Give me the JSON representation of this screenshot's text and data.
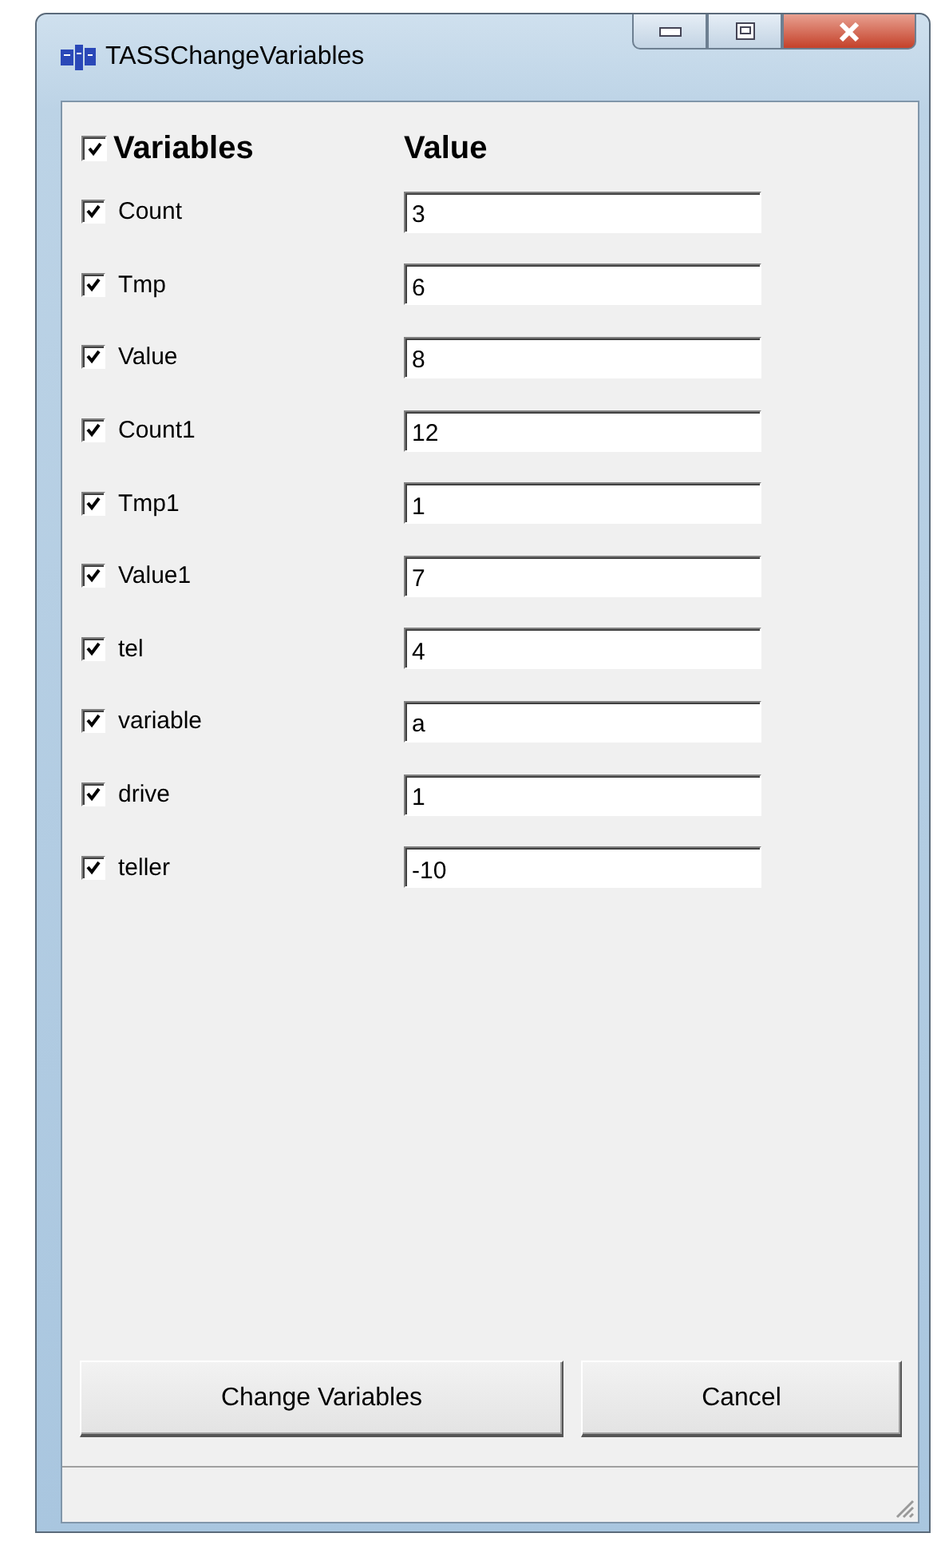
{
  "window": {
    "title": "TASSChangeVariables"
  },
  "header": {
    "checked": true,
    "variables_label": "Variables",
    "value_label": "Value"
  },
  "variables": [
    {
      "name": "Count",
      "checked": true,
      "value": "3"
    },
    {
      "name": "Tmp",
      "checked": true,
      "value": "6"
    },
    {
      "name": "Value",
      "checked": true,
      "value": "8"
    },
    {
      "name": "Count1",
      "checked": true,
      "value": "12"
    },
    {
      "name": "Tmp1",
      "checked": true,
      "value": "1"
    },
    {
      "name": "Value1",
      "checked": true,
      "value": "7"
    },
    {
      "name": "tel",
      "checked": true,
      "value": "4"
    },
    {
      "name": "variable",
      "checked": true,
      "value": "a"
    },
    {
      "name": "drive",
      "checked": true,
      "value": "1"
    },
    {
      "name": "teller",
      "checked": true,
      "value": "-10"
    }
  ],
  "buttons": [
    {
      "label": "Change Variables"
    },
    {
      "label": "Cancel"
    }
  ]
}
